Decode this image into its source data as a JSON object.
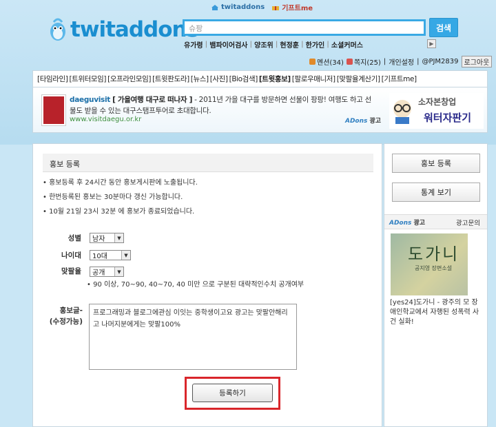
{
  "toplinks": {
    "twitaddons": "twitaddons",
    "giftme": "기프트me"
  },
  "logo": {
    "text": "twitaddons"
  },
  "search": {
    "value": "슈팡",
    "button": "검색"
  },
  "hot_keywords": [
    "유가령",
    "뱀파이어검사",
    "양조위",
    "현정훈",
    "한가인",
    "소셜커머스"
  ],
  "userbar": {
    "mention": "멘션(34)",
    "dm": "쪽지(25)",
    "settings": "개인설정",
    "user": "@PJM2839",
    "logout": "로그아웃"
  },
  "nav": [
    "[타임라인]",
    "[트위터모임]",
    "[오프라인모임]",
    "[트윗판도라]",
    "[뉴스]",
    "[사진]",
    "[Bio검색]",
    "[트윗홍보]",
    "[팔로우매니저]",
    "[맞팔율계산기]",
    "[기프트me]"
  ],
  "ad": {
    "advertiser": "daeguvisit",
    "headline": "[ 가을여행 대구로 떠나자 ]",
    "body": "- 2011년 가을 대구를 방문하면 선물이 팡팡! 여행도 하고 선물도 받을 수 있는 대구스탬프투어로 초대합니다.",
    "url": "www.visitdaegu.or.kr",
    "brand": "ADons",
    "brand_suffix": "광고",
    "right_line1": "소자본창업",
    "right_line2": "워터자판기"
  },
  "main": {
    "title": "홍보 등록",
    "notes": [
      "• 홍보등록 후 24시간 동안 홍보게시판에 노출됩니다.",
      "• 한번등록된 홍보는 30분마다 갱신 가능합니다.",
      "• 10월 21일 23시 32분 에 홍보가 종료되었습니다."
    ],
    "gender_label": "성별",
    "gender_value": "남자",
    "age_label": "나이대",
    "age_value": "10대",
    "match_label": "맞팔율",
    "match_value": "공개",
    "match_desc": "• 90 이상, 70~90, 40~70, 40 미만 으로 구분된 대략적인수치 공개여부",
    "post_label_1": "홍보글-",
    "post_label_2": "(수정가능)",
    "post_text": "프로그래밍과 블로그에관심 이잇는  중학생이고요 광고는 맞팔안해리고  나머지분에게는 맞팔100%",
    "submit": "등록하기"
  },
  "sidebar": {
    "btn_register": "홍보 등록",
    "btn_stats": "통계 보기",
    "ad_brand": "ADons",
    "ad_brand_suffix": "광고",
    "ad_inquiry": "광고문의",
    "book_title": "도가니",
    "book_sub": "공지영 장편소설",
    "book_caption": "[yes24]도가니 - 광주의 모 장애인학교에서 자행된 성폭력 사건 실화!"
  },
  "colors": {
    "accent": "#36a8e5",
    "highlight": "#d9262b",
    "ad_green": "#3e8f3e"
  }
}
